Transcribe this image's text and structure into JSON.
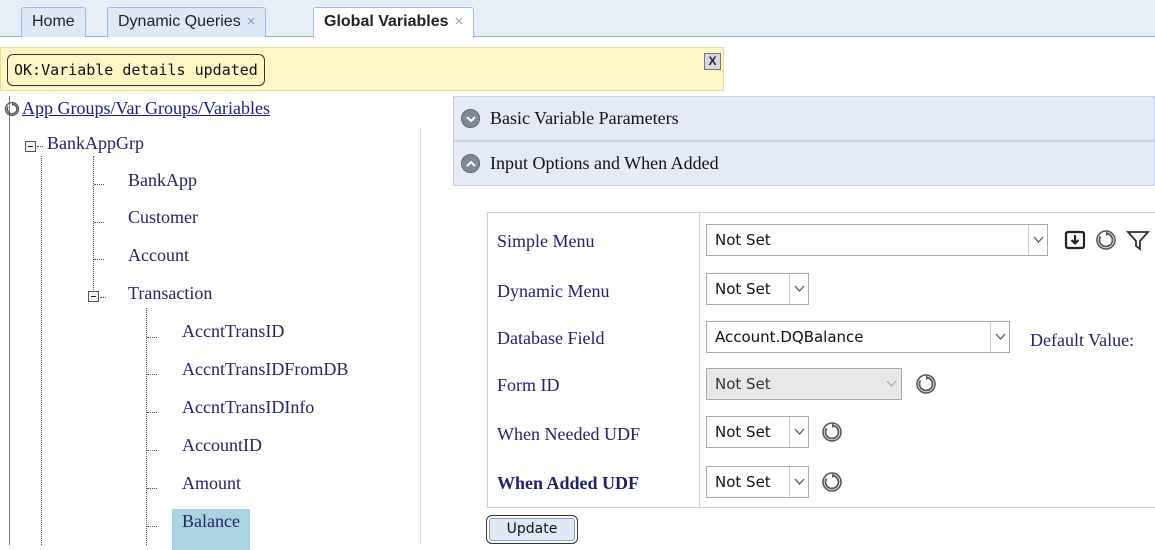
{
  "tabs": [
    {
      "label": "Home",
      "closable": false
    },
    {
      "label": "Dynamic Queries",
      "closable": true
    },
    {
      "label": "Global Variables",
      "closable": true,
      "active": true
    }
  ],
  "tab_close_glyph": "×",
  "status": {
    "message": "OK:Variable details updated",
    "close_label": "X"
  },
  "tree": {
    "root_label": "App Groups/Var Groups/Variables",
    "root_icon": "refresh-icon",
    "app_group": "BankAppGrp",
    "var_groups": [
      "BankApp",
      "Customer",
      "Account",
      "Transaction"
    ],
    "variables": [
      "AccntTransID",
      "AccntTransIDFromDB",
      "AccntTransIDInfo",
      "AccountID",
      "Amount",
      "Balance"
    ],
    "selected": "Balance"
  },
  "accordion": {
    "basic": "Basic Variable Parameters",
    "input": "Input Options and When Added"
  },
  "form": {
    "simple_menu": {
      "label": "Simple Menu",
      "value": "Not Set"
    },
    "dynamic_menu": {
      "label": "Dynamic Menu",
      "value": "Not Set"
    },
    "database_field": {
      "label": "Database Field",
      "value": "Account.DQBalance"
    },
    "default_value_label": "Default Value:",
    "form_id": {
      "label": "Form ID",
      "value": "Not Set",
      "disabled": true
    },
    "when_needed_udf": {
      "label": "When Needed UDF",
      "value": "Not Set"
    },
    "when_added_udf": {
      "label": "When Added UDF",
      "value": "Not Set"
    },
    "update_label": "Update"
  },
  "icons": [
    "download-icon",
    "refresh-icon",
    "filter-icon",
    "chevron-down-icon",
    "chevron-up-icon"
  ],
  "colors": {
    "link": "#1a1a8a",
    "selected": "#aad4e4",
    "status_bg": "#fdf6c5",
    "accordion_bg": "#e4ebf6"
  }
}
